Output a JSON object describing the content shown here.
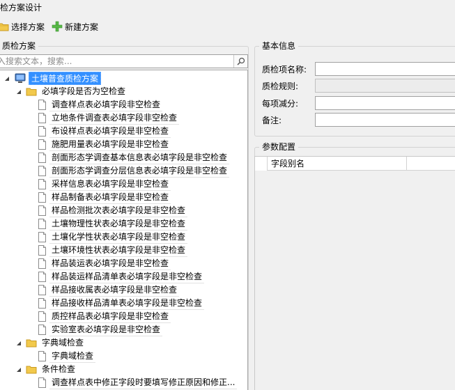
{
  "window": {
    "title": "检方案设计"
  },
  "toolbar": {
    "select_label": "选择方案",
    "new_label": "新建方案",
    "select_icon_color": "#f2c94c",
    "new_icon_color": "#57b947"
  },
  "left_panel": {
    "legend": "质检方案",
    "search_placeholder": "入搜索文本，搜索...",
    "tree": {
      "root": "土壤普查质检方案",
      "groups": [
        {
          "label": "必填字段是否为空检查",
          "items": [
            "调查样点表必填字段非空检查",
            "立地条件调查表必填字段非空检查",
            "布设样点表必填字段是非空检查",
            "施肥用量表必填字段是非空检查",
            "剖面形态学调查基本信息表必填字段是非空检查",
            "剖面形态学调查分层信息表必填字段是非空检查",
            "采样信息表必填字段是非空检查",
            "样品制备表必填字段是非空检查",
            "样品检测批次表必填字段是非空检查",
            "土壤物理性状表必填字段是非空检查",
            "土壤化学性状表必填字段是非空检查",
            "土壤环境性状表必填字段是非空检查",
            "样品装运表必填字段是非空检查",
            "样品装运样品清单表必填字段是非空检查",
            "样品接收属表必填字段是非空检查",
            "样品接收样品清单表必填字段是非空检查",
            "质控样品表必填字段是非空检查",
            "实验室表必填字段是非空检查"
          ]
        },
        {
          "label": "字典域检查",
          "items": [
            "字典域检查"
          ]
        },
        {
          "label": "条件检查",
          "items": [
            "调查样点表中修正字段时要填写修正原因和修正..."
          ]
        }
      ]
    }
  },
  "basic_info": {
    "legend": "基本信息",
    "fields": [
      {
        "label": "质检项名称:",
        "value": ""
      },
      {
        "label": "质检规则:",
        "value": ""
      },
      {
        "label": "每项减分:",
        "value": ""
      },
      {
        "label": "备注:",
        "value": ""
      }
    ]
  },
  "param_config": {
    "legend": "参数配置",
    "columns": [
      "字段别名"
    ]
  },
  "colors": {
    "selection": "#3390ff",
    "folder": "#f2c94c"
  }
}
